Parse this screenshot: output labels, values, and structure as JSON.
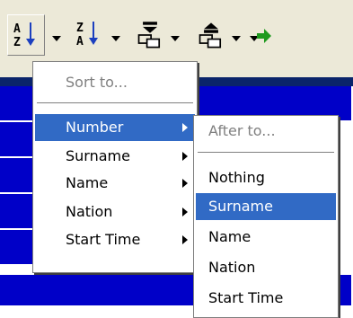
{
  "toolbar": {
    "buttons": [
      {
        "icon": "sort-ascending-az-icon",
        "letters_top": "A",
        "letters_bottom": "Z"
      },
      {
        "icon": "sort-descending-za-icon",
        "letters_top": "Z",
        "letters_bottom": "A"
      },
      {
        "icon": "move-bottom-icon"
      },
      {
        "icon": "move-top-icon"
      },
      {
        "icon": "green-arrow-icon"
      }
    ]
  },
  "sort_menu": {
    "header": "Sort to...",
    "items": [
      {
        "label": "Number",
        "has_submenu": true,
        "highlighted": true
      },
      {
        "label": "Surname",
        "has_submenu": true
      },
      {
        "label": "Name",
        "has_submenu": true
      },
      {
        "label": "Nation",
        "has_submenu": true
      },
      {
        "label": "Start Time",
        "has_submenu": true
      }
    ]
  },
  "after_menu": {
    "header": "After to...",
    "items": [
      {
        "label": "Nothing"
      },
      {
        "label": "Surname",
        "highlighted": true
      },
      {
        "label": "Name"
      },
      {
        "label": "Nation"
      },
      {
        "label": "Start Time"
      }
    ]
  },
  "colors": {
    "menu_highlight": "#316ac5",
    "grid_blue": "#0000c8",
    "toolbar_bg": "#ece9d8"
  }
}
